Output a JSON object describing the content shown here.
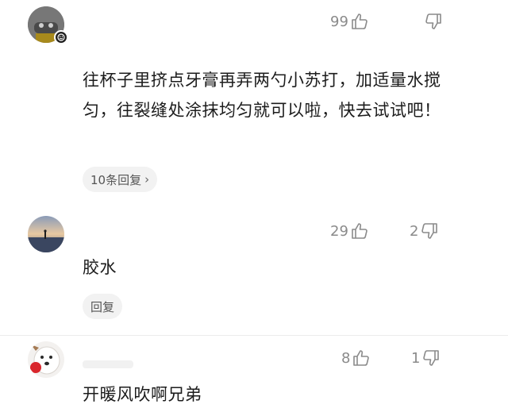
{
  "comments": [
    {
      "likes": "99",
      "dislikes": "",
      "text": "往杯子里挤点牙膏再弄两勺小苏打，加适量水搅匀，往裂缝处涂抹均匀就可以啦，快去试试吧！",
      "reply_label": "10条回复"
    },
    {
      "likes": "29",
      "dislikes": "2",
      "text": "胶水",
      "reply_label": "回复"
    },
    {
      "likes": "8",
      "dislikes": "1",
      "text": "开暖风吹啊兄弟"
    }
  ],
  "colors": {
    "icon_gray": "#8a8a8a",
    "pill_bg": "#f2f2f2",
    "text": "#1c1c1c"
  },
  "icons": {
    "like": "thumb-up-icon",
    "dislike": "thumb-down-icon",
    "chevron": "chevron-right-icon"
  }
}
